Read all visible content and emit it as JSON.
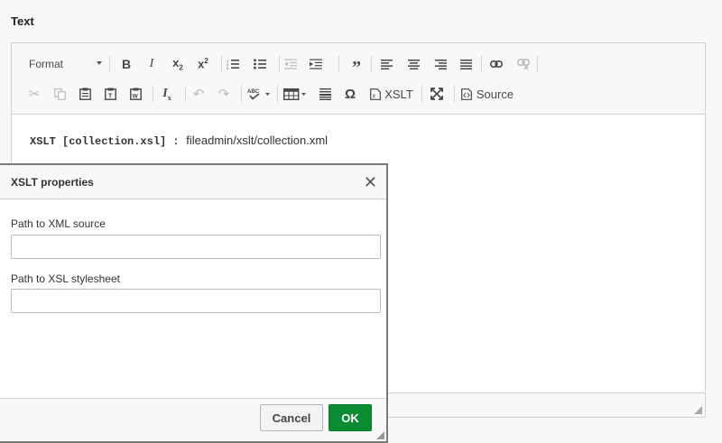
{
  "field": {
    "label": "Text"
  },
  "toolbar": {
    "format_label": "Format",
    "xslt_label": "XSLT",
    "source_label": "Source"
  },
  "content": {
    "code": "XSLT [collection.xsl] :",
    "path": "fileadmin/xslt/collection.xml"
  },
  "dialog": {
    "title": "XSLT properties",
    "xml_label": "Path to XML source",
    "xml_value": "",
    "xsl_label": "Path to XSL stylesheet",
    "xsl_value": "",
    "cancel_label": "Cancel",
    "ok_label": "OK"
  },
  "colors": {
    "ok_button": "#0b8b32",
    "dialog_border": "#7a7a7a"
  }
}
